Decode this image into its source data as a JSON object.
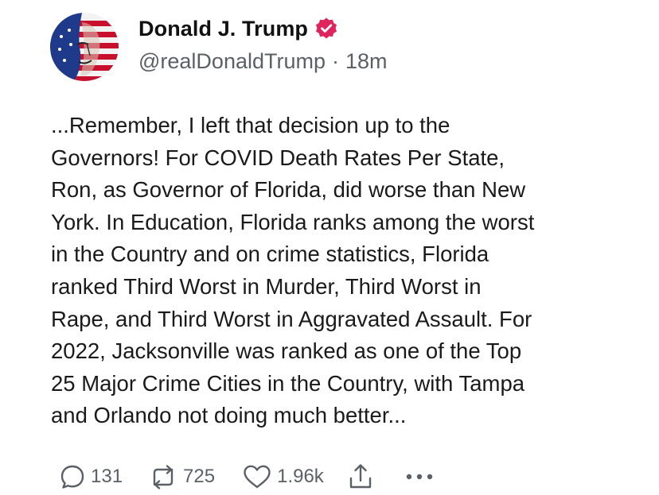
{
  "author": {
    "display_name": "Donald J. Trump",
    "handle": "@realDonaldTrump",
    "separator": "·",
    "time": "18m",
    "verified_color": "#e0245e"
  },
  "post": {
    "text": "...Remember, I left that decision up to the\nGovernors! For COVID Death Rates Per State,\nRon, as Governor of Florida, did worse than New\nYork. In Education, Florida ranks among the worst\nin the Country and on crime statistics, Florida\nranked Third Worst in Murder, Third Worst in\nRape, and Third Worst in Aggravated Assault. For\n2022, Jacksonville was ranked as one of the Top\n25 Major Crime Cities in the Country, with Tampa\nand Orlando not doing much better..."
  },
  "actions": {
    "replies": "131",
    "reposts": "725",
    "likes": "1.96k",
    "icons": [
      "reply-icon",
      "repost-icon",
      "like-icon",
      "share-icon",
      "more-icon"
    ]
  }
}
